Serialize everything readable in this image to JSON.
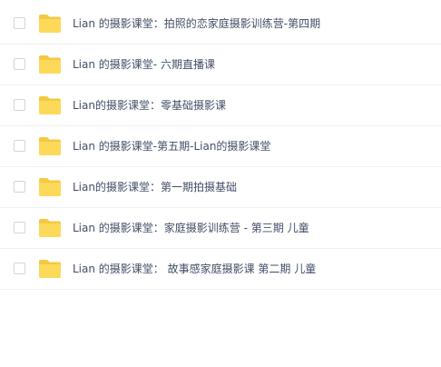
{
  "files": [
    {
      "name": "Lian 的摄影课堂：拍照的恋家庭摄影训练营-第四期",
      "icon": "folder-icon",
      "checked": false
    },
    {
      "name": "Lian 的摄影课堂- 六期直播课",
      "icon": "folder-icon",
      "checked": false
    },
    {
      "name": "Lian的摄影课堂：零基础摄影课",
      "icon": "folder-icon",
      "checked": false
    },
    {
      "name": "Lian 的摄影课堂-第五期-Lian的摄影课堂",
      "icon": "folder-icon",
      "checked": false
    },
    {
      "name": "Lian的摄影课堂：第一期拍摄基础",
      "icon": "folder-icon",
      "checked": false
    },
    {
      "name": "Lian 的摄影课堂：家庭摄影训练营 - 第三期 儿童",
      "icon": "folder-icon",
      "checked": false
    },
    {
      "name": "Lian 的摄影课堂： 故事感家庭摄影课 第二期 儿童",
      "icon": "folder-icon",
      "checked": false
    }
  ],
  "colors": {
    "folder_back": "#f5c842",
    "folder_front": "#fdd95a",
    "text": "#424e67",
    "row_border": "#f0f0f0"
  }
}
